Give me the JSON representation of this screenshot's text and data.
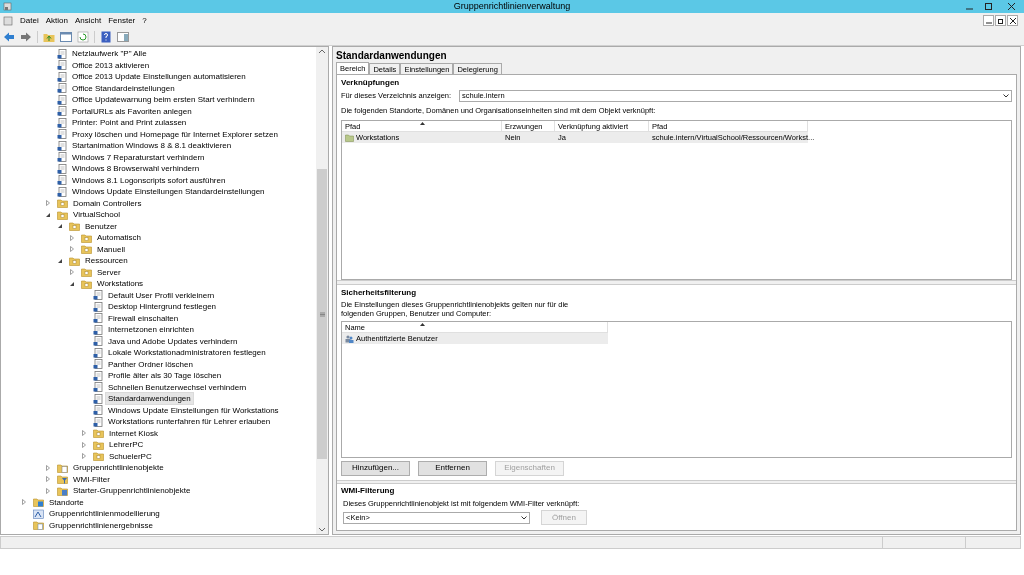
{
  "window": {
    "title": "Gruppenrichtlinienverwaltung"
  },
  "menu": [
    "Datei",
    "Aktion",
    "Ansicht",
    "Fenster",
    "?"
  ],
  "tree": [
    {
      "children": [
        {
          "children": [
            {
              "kind": "gpo",
              "label": "Netzlaufwerk \"P\" Alle",
              "selected": false
            },
            {
              "kind": "gpo",
              "label": "Office 2013 aktivieren",
              "selected": false
            },
            {
              "kind": "gpo",
              "label": "Office 2013 Update Einstellungen automatisieren",
              "selected": false
            },
            {
              "kind": "gpo",
              "label": "Office Standardeinstellungen",
              "selected": false
            },
            {
              "kind": "gpo",
              "label": "Office Updatewarnung beim ersten Start  verhindern",
              "selected": false
            },
            {
              "kind": "gpo",
              "label": "PortalURLs als Favoriten anlegen",
              "selected": false
            },
            {
              "kind": "gpo",
              "label": "Printer: Point and Print zulassen",
              "selected": false
            },
            {
              "kind": "gpo",
              "label": "Proxy löschen und Homepage für Internet Explorer setzen",
              "selected": false
            },
            {
              "kind": "gpo",
              "label": "Startanimation Windows 8 & 8.1 deaktivieren",
              "selected": false
            },
            {
              "kind": "gpo",
              "label": "Windows 7 Reparaturstart verhindern",
              "selected": false
            },
            {
              "kind": "gpo",
              "label": "Windows 8 Browserwahl verhindern",
              "selected": false
            },
            {
              "kind": "gpo",
              "label": "Windows 8.1 Logonscripts sofort ausführen",
              "selected": false
            },
            {
              "kind": "gpo",
              "label": "Windows Update Einstellungen Standardeinstellungen",
              "selected": false
            },
            {
              "kind": "folder",
              "label": "Domain Controllers",
              "expanded": false,
              "selected": false
            },
            {
              "kind": "folder",
              "label": "VirtualSchool",
              "expanded": true,
              "selected": false,
              "children": [
                {
                  "kind": "folder",
                  "label": "Benutzer",
                  "expanded": true,
                  "selected": false,
                  "children": [
                    {
                      "kind": "folder",
                      "label": "Automatisch",
                      "expanded": false,
                      "selected": false
                    },
                    {
                      "kind": "folder",
                      "label": "Manuell",
                      "expanded": false,
                      "selected": false
                    }
                  ]
                },
                {
                  "kind": "folder",
                  "label": "Ressourcen",
                  "expanded": true,
                  "selected": false,
                  "children": [
                    {
                      "kind": "folder",
                      "label": "Server",
                      "expanded": false,
                      "selected": false
                    },
                    {
                      "kind": "folder",
                      "label": "Workstations",
                      "expanded": true,
                      "selected": false,
                      "children": [
                        {
                          "kind": "gpo",
                          "label": "Default User Profil verkleinern",
                          "selected": false
                        },
                        {
                          "kind": "gpo",
                          "label": "Desktop Hintergrund festlegen",
                          "selected": false
                        },
                        {
                          "kind": "gpo",
                          "label": "Firewall einschalten",
                          "selected": false
                        },
                        {
                          "kind": "gpo",
                          "label": "Internetzonen einrichten",
                          "selected": false
                        },
                        {
                          "kind": "gpo",
                          "label": "Java und Adobe Updates verhindern",
                          "selected": false
                        },
                        {
                          "kind": "gpo",
                          "label": "Lokale Workstationadministratoren festlegen",
                          "selected": false
                        },
                        {
                          "kind": "gpo",
                          "label": "Panther Ordner löschen",
                          "selected": false
                        },
                        {
                          "kind": "gpo",
                          "label": "Profile älter als 30 Tage löschen",
                          "selected": false
                        },
                        {
                          "kind": "gpo",
                          "label": "Schnellen Benutzerwechsel verhindern",
                          "selected": false
                        },
                        {
                          "kind": "gpo",
                          "label": "Standardanwendungen",
                          "selected": true
                        },
                        {
                          "kind": "gpo",
                          "label": "Windows Update Einstellungen für Workstations",
                          "selected": false
                        },
                        {
                          "kind": "gpo",
                          "label": "Workstations runterfahren für Lehrer erlauben",
                          "selected": false
                        },
                        {
                          "kind": "folder",
                          "label": "Internet Kiosk",
                          "expanded": false,
                          "selected": false
                        },
                        {
                          "kind": "folder",
                          "label": "LehrerPC",
                          "expanded": false,
                          "selected": false
                        },
                        {
                          "kind": "folder",
                          "label": "SchuelerPC",
                          "expanded": false,
                          "selected": false
                        }
                      ]
                    }
                  ]
                }
              ]
            },
            {
              "kind": "gpo_container",
              "label": "Gruppenrichtlinienobjekte",
              "expanded": false,
              "selected": false
            },
            {
              "kind": "wmi",
              "label": "WMI-Filter",
              "expanded": false,
              "selected": false
            },
            {
              "kind": "starter",
              "label": "Starter-Gruppenrichtlinienobjekte",
              "expanded": false,
              "selected": false
            }
          ]
        }
      ]
    },
    {
      "kind": "sites",
      "label": "Standorte",
      "expanded": false,
      "selected": false
    },
    {
      "kind": "modeling",
      "label": "Gruppenrichtlinienmodellierung",
      "selected": false
    },
    {
      "kind": "results",
      "label": "Gruppenrichtlinienergebnisse",
      "selected": false
    }
  ],
  "details": {
    "title": "Standardanwendungen",
    "tabs": [
      {
        "label": "Bereich",
        "selected": true
      },
      {
        "label": "Details",
        "selected": false
      },
      {
        "label": "Einstellungen",
        "selected": false
      },
      {
        "label": "Delegierung",
        "selected": false
      }
    ],
    "links": {
      "heading": "Verknüpfungen",
      "directory_label": "Für dieses Verzeichnis anzeigen:",
      "directory_value": "schule.intern",
      "description": "Die folgenden Standorte, Domänen und Organisationseinheiten sind mit dem Objekt verknüpft:",
      "columns": [
        "Pfad",
        "Erzwungen",
        "Verknüpfung aktiviert",
        "Pfad"
      ],
      "rows": [
        {
          "cells": [
            "Workstations",
            "Nein",
            "Ja",
            "schule.intern/VirtualSchool/Ressourcen/Workst..."
          ],
          "selected": true
        }
      ]
    },
    "security": {
      "heading": "Sicherheitsfilterung",
      "description": "Die Einstellungen dieses Gruppenrichtlinienobjekts gelten nur für die folgenden Gruppen, Benutzer und Computer:",
      "columns": [
        "Name"
      ],
      "rows": [
        {
          "cells": [
            "Authentifizierte Benutzer"
          ],
          "selected": true
        }
      ],
      "buttons": [
        {
          "label": "Hinzufügen...",
          "disabled": false
        },
        {
          "label": "Entfernen",
          "disabled": false
        },
        {
          "label": "Eigenschaften",
          "disabled": true
        }
      ]
    },
    "wmi": {
      "heading": "WMI-Filterung",
      "description": "Dieses Gruppenrichtlinienobjekt ist mit folgendem WMI-Filter verknüpft:",
      "value": "<Kein>",
      "button": {
        "label": "Öffnen",
        "disabled": true
      }
    }
  }
}
